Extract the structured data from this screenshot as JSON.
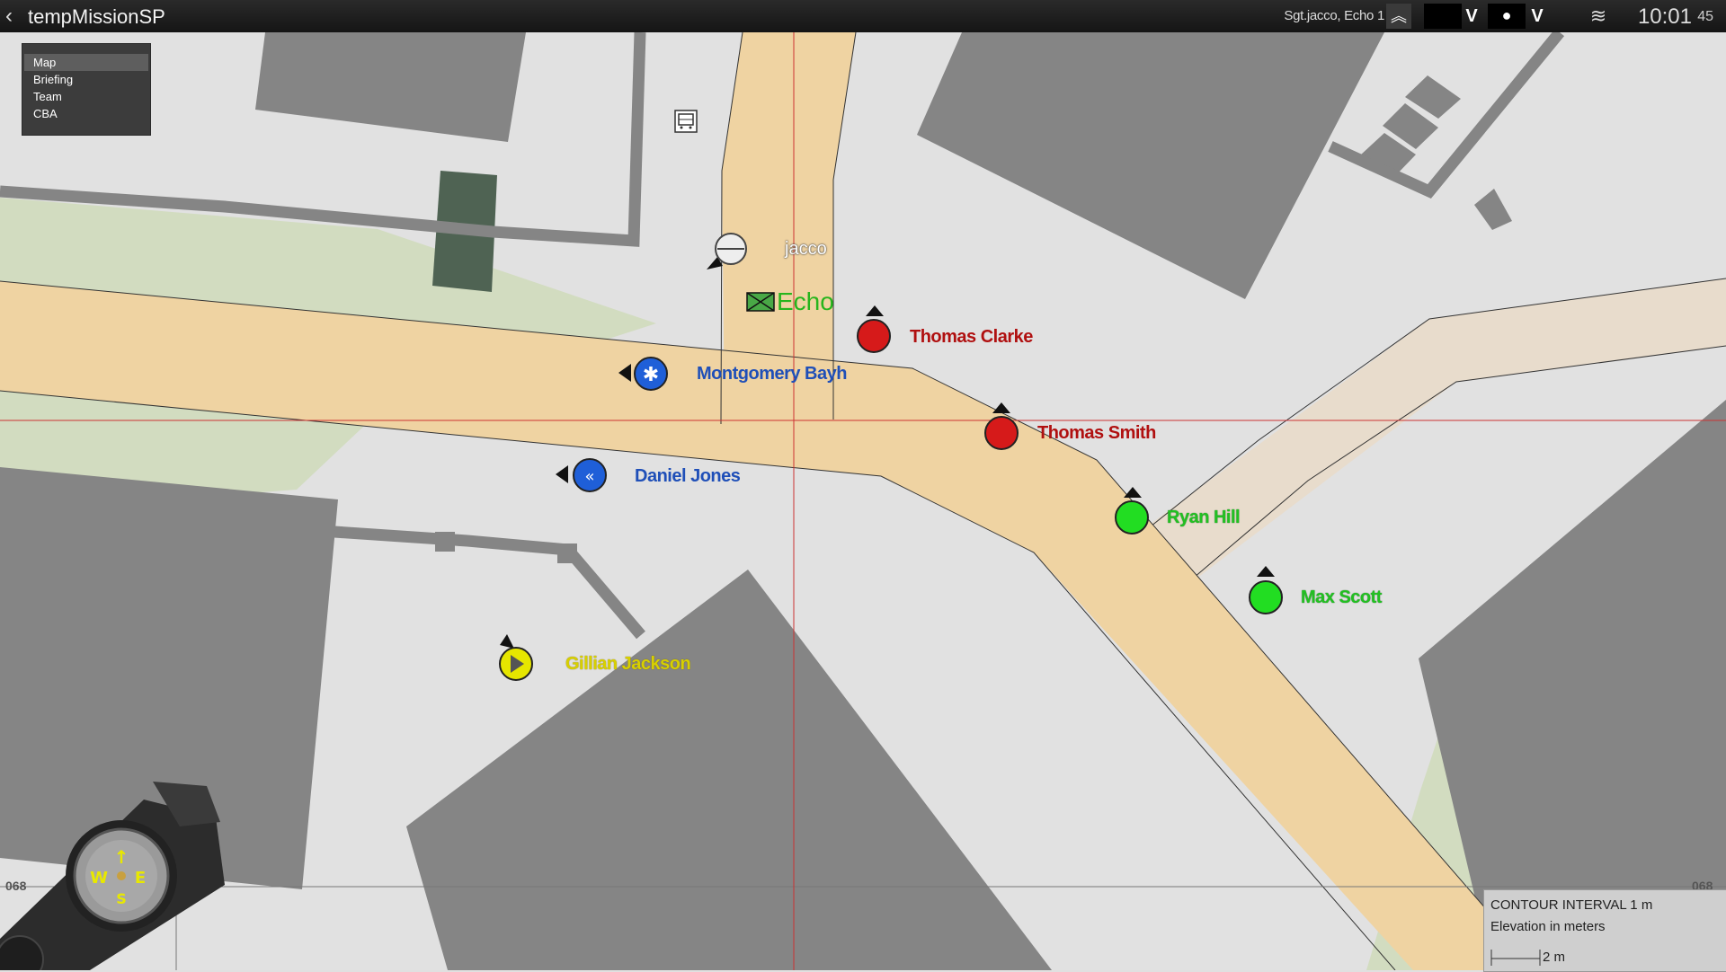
{
  "app": {
    "title": "tempMissionSP",
    "player": "Sgt.jacco, Echo 1",
    "time": "10:01",
    "seconds": "45"
  },
  "menu": {
    "items": [
      "Map",
      "Briefing",
      "Team",
      "CBA"
    ],
    "active": "Map"
  },
  "map": {
    "player_label": "jacco",
    "group_label": "Echo",
    "units": [
      {
        "name": "Thomas Clarke",
        "color": "#d61a1a"
      },
      {
        "name": "Thomas Smith",
        "color": "#d61a1a"
      },
      {
        "name": "Montgomery Bayh",
        "color": "#1f5fd8"
      },
      {
        "name": "Daniel Jones",
        "color": "#1f5fd8"
      },
      {
        "name": "Ryan Hill",
        "color": "#22dd22"
      },
      {
        "name": "Max Scott",
        "color": "#22dd22"
      },
      {
        "name": "Gillian Jackson",
        "color": "#e6e600"
      }
    ],
    "grid_left": "068",
    "grid_right": "068"
  },
  "legend": {
    "contour": "CONTOUR INTERVAL 1 m",
    "elevation": "Elevation in meters",
    "scale": "2 m"
  }
}
